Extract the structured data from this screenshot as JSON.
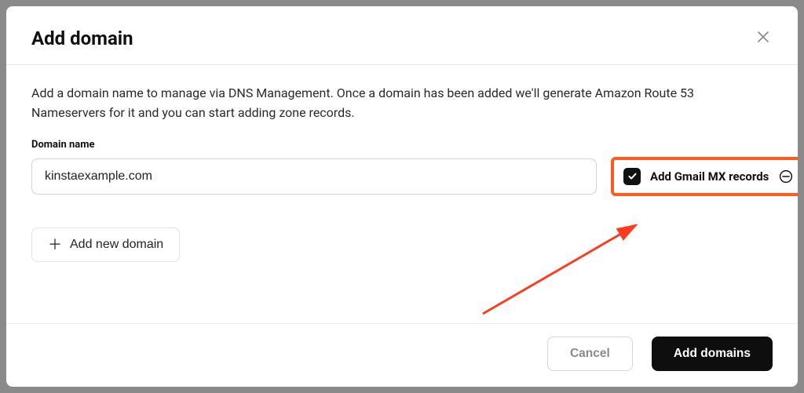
{
  "modal": {
    "title": "Add domain",
    "description": "Add a domain name to manage via DNS Management. Once a domain has been added we'll generate Amazon Route 53 Nameservers for it and you can start adding zone records.",
    "field_label": "Domain name",
    "domain_value": "kinstaexample.com",
    "mx_checkbox_label": "Add Gmail MX records",
    "mx_checked": true,
    "add_new_label": "Add new domain",
    "cancel_label": "Cancel",
    "submit_label": "Add domains"
  },
  "colors": {
    "highlight": "#ff5a1f",
    "primary_button_bg": "#0e0e0e"
  }
}
